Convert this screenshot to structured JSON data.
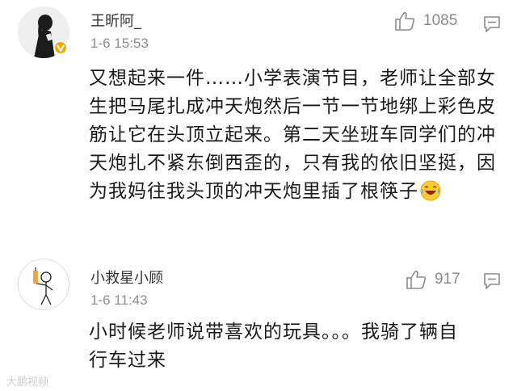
{
  "comments": [
    {
      "username": "王昕阿_",
      "timestamp": "1-6 15:53",
      "likes": "1085",
      "verified": true,
      "avatar_icon": "woman-silhouette-avatar-icon",
      "text": "又想起来一件……小学表演节目，老师让全部女生把马尾扎成冲天炮然后一节一节地绑上彩色皮筋让它在头顶立起来。第二天坐班车同学们的冲天炮扎不紧东倒西歪的，只有我的依旧坚挺，因为我妈往我头顶的冲天炮里插了根筷子",
      "trailing_emoji": "laughing-crying-emoji-icon"
    },
    {
      "username": "小救星小顾",
      "timestamp": "1-6 11:43",
      "likes": "917",
      "verified": false,
      "avatar_icon": "stick-figure-avatar-icon",
      "text": "小时候老师说带喜欢的玩具。。。我骑了辆自行车过来"
    }
  ],
  "watermark": "大鹏视频",
  "colors": {
    "badge": "#f7a600",
    "meta_gray": "#8e8e8e",
    "text": "#1a1a1a"
  }
}
